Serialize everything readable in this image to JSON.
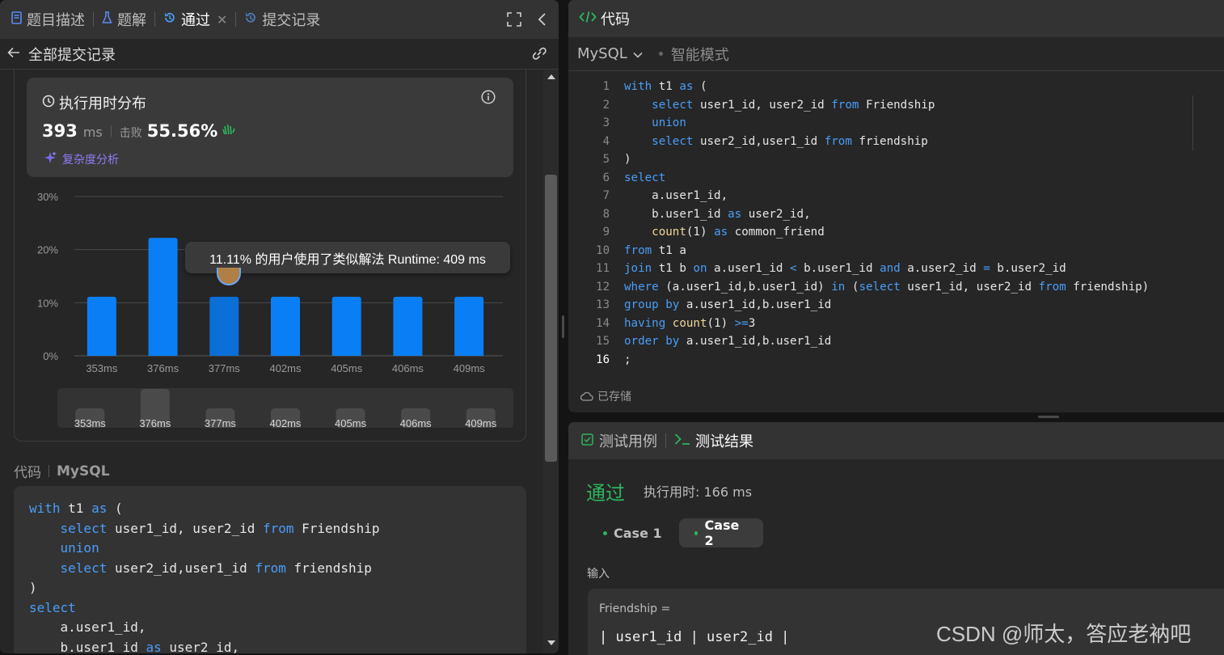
{
  "left": {
    "tabs": [
      {
        "label": "题目描述"
      },
      {
        "label": "题解"
      },
      {
        "label": "通过"
      },
      {
        "label": "提交记录"
      }
    ],
    "subheader": {
      "back_label": "全部提交记录"
    },
    "runtime_card": {
      "title": "执行用时分布",
      "value": "393",
      "unit": "ms",
      "beats_label": "击败",
      "beats_value": "55.56%",
      "complexity_link": "复杂度分析"
    },
    "tooltip": "11.11% 的用户使用了类似解法 Runtime: 409 ms",
    "code_header": {
      "label": "代码",
      "language": "MySQL"
    },
    "code_lines": [
      "with t1 as (",
      "    select user1_id, user2_id from Friendship",
      "    union",
      "    select user2_id,user1_id from friendship",
      ")",
      "select",
      "    a.user1_id,",
      "    b.user1_id as user2_id,"
    ]
  },
  "chart_data": {
    "type": "bar",
    "categories": [
      "353ms",
      "376ms",
      "377ms",
      "402ms",
      "405ms",
      "406ms",
      "409ms"
    ],
    "values": [
      11.11,
      22.22,
      11.11,
      11.11,
      11.11,
      11.11,
      11.11
    ],
    "yticks": [
      "30%",
      "20%",
      "10%",
      "0%"
    ],
    "ylim": [
      0,
      30
    ],
    "highlight": "377ms",
    "bar_color": "#0a7ff5",
    "highlight_color": "#0b6fd8",
    "minimap_categories": [
      "353ms",
      "376ms",
      "377ms",
      "402ms",
      "405ms",
      "406ms",
      "409ms"
    ]
  },
  "right_top": {
    "title": "代码",
    "language": "MySQL",
    "mode": "智能模式",
    "saved": "已存储",
    "line_numbers": [
      "1",
      "2",
      "3",
      "4",
      "5",
      "6",
      "7",
      "8",
      "9",
      "10",
      "11",
      "12",
      "13",
      "14",
      "15",
      "16"
    ],
    "code_lines": [
      "with t1 as (",
      "    select user1_id, user2_id from Friendship",
      "    union",
      "    select user2_id,user1_id from friendship",
      ")",
      "select",
      "    a.user1_id,",
      "    b.user1_id as user2_id,",
      "    count(1) as common_friend",
      "from t1 a",
      "join t1 b on a.user1_id < b.user1_id and a.user2_id = b.user2_id",
      "where (a.user1_id,b.user1_id) in (select user1_id, user2_id from friendship)",
      "group by a.user1_id,b.user1_id",
      "having count(1) >=3",
      "order by a.user1_id,b.user1_id",
      ";"
    ]
  },
  "right_bottom": {
    "tabs": [
      {
        "label": "测试用例"
      },
      {
        "label": "测试结果"
      }
    ],
    "status": "通过",
    "runtime": "执行用时: 166 ms",
    "cases": [
      {
        "label": "Case 1"
      },
      {
        "label": "Case 2"
      }
    ],
    "input_label": "输入",
    "table_name": "Friendship =",
    "table_header": "| user1_id | user2_id |",
    "watermark": "CSDN @师太，答应老衲吧"
  },
  "colors": {
    "accent_green": "#2db55d",
    "accent_blue": "#0a7ff5",
    "keyword": "#4a9df8",
    "function": "#f2d69a"
  }
}
